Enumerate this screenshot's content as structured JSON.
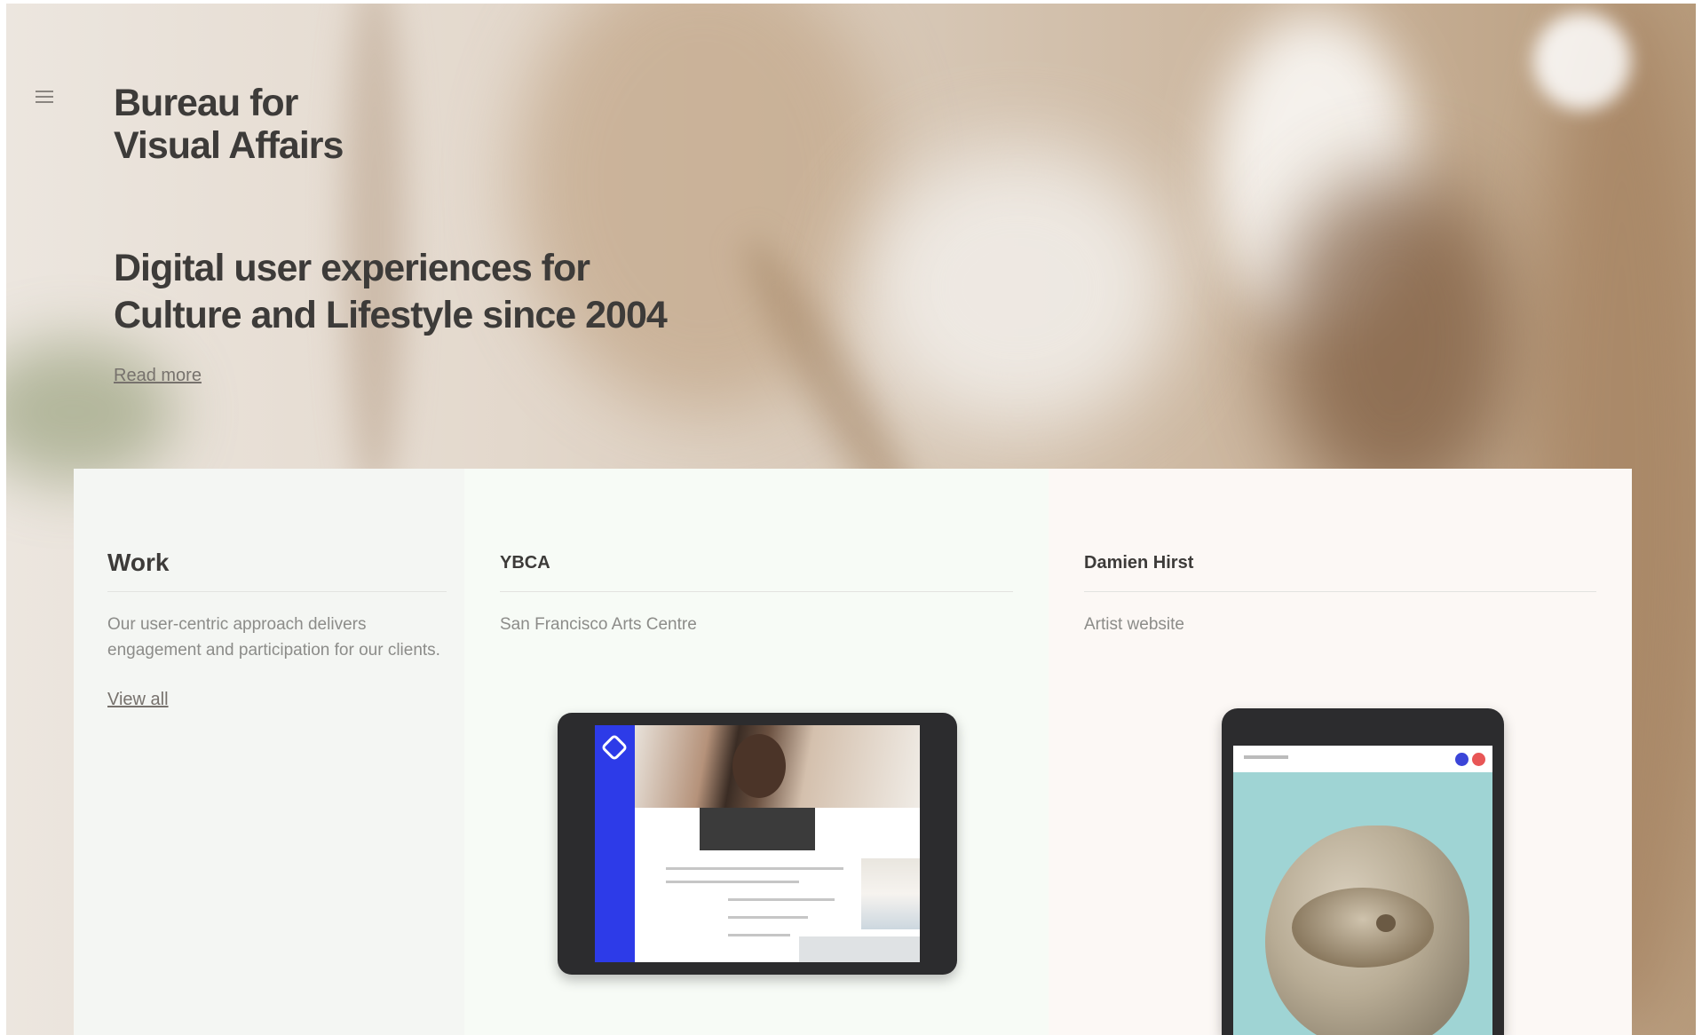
{
  "hero": {
    "brand_line1": "Bureau for",
    "brand_line2": "Visual Affairs",
    "headline_line1": "Digital user experiences for",
    "headline_line2": "Culture and Lifestyle since 2004",
    "read_more": "Read more"
  },
  "work": {
    "title": "Work",
    "description": "Our user-centric approach delivers engagement and participation for our clients.",
    "view_all": "View all"
  },
  "projects": [
    {
      "title": "YBCA",
      "subtitle": "San Francisco Arts Centre"
    },
    {
      "title": "Damien Hirst",
      "subtitle": "Artist website"
    }
  ],
  "icons": {
    "menu": "hamburger-menu-icon"
  },
  "colors": {
    "text_dark": "#3d3b39",
    "text_muted": "#8c8c89",
    "ybca_blue": "#2d3be8",
    "dot_blue": "#3b45d8",
    "dot_red": "#e85656"
  }
}
